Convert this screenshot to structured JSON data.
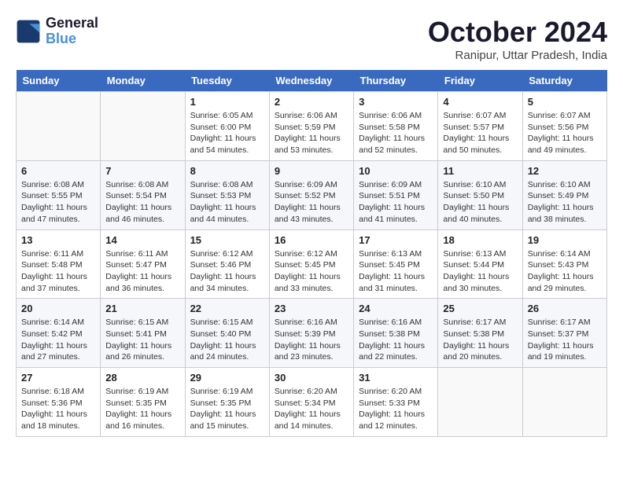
{
  "logo": {
    "line1": "General",
    "line2": "Blue"
  },
  "title": "October 2024",
  "location": "Ranipur, Uttar Pradesh, India",
  "days_of_week": [
    "Sunday",
    "Monday",
    "Tuesday",
    "Wednesday",
    "Thursday",
    "Friday",
    "Saturday"
  ],
  "weeks": [
    [
      {
        "day": "",
        "text": ""
      },
      {
        "day": "",
        "text": ""
      },
      {
        "day": "1",
        "text": "Sunrise: 6:05 AM\nSunset: 6:00 PM\nDaylight: 11 hours and 54 minutes."
      },
      {
        "day": "2",
        "text": "Sunrise: 6:06 AM\nSunset: 5:59 PM\nDaylight: 11 hours and 53 minutes."
      },
      {
        "day": "3",
        "text": "Sunrise: 6:06 AM\nSunset: 5:58 PM\nDaylight: 11 hours and 52 minutes."
      },
      {
        "day": "4",
        "text": "Sunrise: 6:07 AM\nSunset: 5:57 PM\nDaylight: 11 hours and 50 minutes."
      },
      {
        "day": "5",
        "text": "Sunrise: 6:07 AM\nSunset: 5:56 PM\nDaylight: 11 hours and 49 minutes."
      }
    ],
    [
      {
        "day": "6",
        "text": "Sunrise: 6:08 AM\nSunset: 5:55 PM\nDaylight: 11 hours and 47 minutes."
      },
      {
        "day": "7",
        "text": "Sunrise: 6:08 AM\nSunset: 5:54 PM\nDaylight: 11 hours and 46 minutes."
      },
      {
        "day": "8",
        "text": "Sunrise: 6:08 AM\nSunset: 5:53 PM\nDaylight: 11 hours and 44 minutes."
      },
      {
        "day": "9",
        "text": "Sunrise: 6:09 AM\nSunset: 5:52 PM\nDaylight: 11 hours and 43 minutes."
      },
      {
        "day": "10",
        "text": "Sunrise: 6:09 AM\nSunset: 5:51 PM\nDaylight: 11 hours and 41 minutes."
      },
      {
        "day": "11",
        "text": "Sunrise: 6:10 AM\nSunset: 5:50 PM\nDaylight: 11 hours and 40 minutes."
      },
      {
        "day": "12",
        "text": "Sunrise: 6:10 AM\nSunset: 5:49 PM\nDaylight: 11 hours and 38 minutes."
      }
    ],
    [
      {
        "day": "13",
        "text": "Sunrise: 6:11 AM\nSunset: 5:48 PM\nDaylight: 11 hours and 37 minutes."
      },
      {
        "day": "14",
        "text": "Sunrise: 6:11 AM\nSunset: 5:47 PM\nDaylight: 11 hours and 36 minutes."
      },
      {
        "day": "15",
        "text": "Sunrise: 6:12 AM\nSunset: 5:46 PM\nDaylight: 11 hours and 34 minutes."
      },
      {
        "day": "16",
        "text": "Sunrise: 6:12 AM\nSunset: 5:45 PM\nDaylight: 11 hours and 33 minutes."
      },
      {
        "day": "17",
        "text": "Sunrise: 6:13 AM\nSunset: 5:45 PM\nDaylight: 11 hours and 31 minutes."
      },
      {
        "day": "18",
        "text": "Sunrise: 6:13 AM\nSunset: 5:44 PM\nDaylight: 11 hours and 30 minutes."
      },
      {
        "day": "19",
        "text": "Sunrise: 6:14 AM\nSunset: 5:43 PM\nDaylight: 11 hours and 29 minutes."
      }
    ],
    [
      {
        "day": "20",
        "text": "Sunrise: 6:14 AM\nSunset: 5:42 PM\nDaylight: 11 hours and 27 minutes."
      },
      {
        "day": "21",
        "text": "Sunrise: 6:15 AM\nSunset: 5:41 PM\nDaylight: 11 hours and 26 minutes."
      },
      {
        "day": "22",
        "text": "Sunrise: 6:15 AM\nSunset: 5:40 PM\nDaylight: 11 hours and 24 minutes."
      },
      {
        "day": "23",
        "text": "Sunrise: 6:16 AM\nSunset: 5:39 PM\nDaylight: 11 hours and 23 minutes."
      },
      {
        "day": "24",
        "text": "Sunrise: 6:16 AM\nSunset: 5:38 PM\nDaylight: 11 hours and 22 minutes."
      },
      {
        "day": "25",
        "text": "Sunrise: 6:17 AM\nSunset: 5:38 PM\nDaylight: 11 hours and 20 minutes."
      },
      {
        "day": "26",
        "text": "Sunrise: 6:17 AM\nSunset: 5:37 PM\nDaylight: 11 hours and 19 minutes."
      }
    ],
    [
      {
        "day": "27",
        "text": "Sunrise: 6:18 AM\nSunset: 5:36 PM\nDaylight: 11 hours and 18 minutes."
      },
      {
        "day": "28",
        "text": "Sunrise: 6:19 AM\nSunset: 5:35 PM\nDaylight: 11 hours and 16 minutes."
      },
      {
        "day": "29",
        "text": "Sunrise: 6:19 AM\nSunset: 5:35 PM\nDaylight: 11 hours and 15 minutes."
      },
      {
        "day": "30",
        "text": "Sunrise: 6:20 AM\nSunset: 5:34 PM\nDaylight: 11 hours and 14 minutes."
      },
      {
        "day": "31",
        "text": "Sunrise: 6:20 AM\nSunset: 5:33 PM\nDaylight: 11 hours and 12 minutes."
      },
      {
        "day": "",
        "text": ""
      },
      {
        "day": "",
        "text": ""
      }
    ]
  ]
}
